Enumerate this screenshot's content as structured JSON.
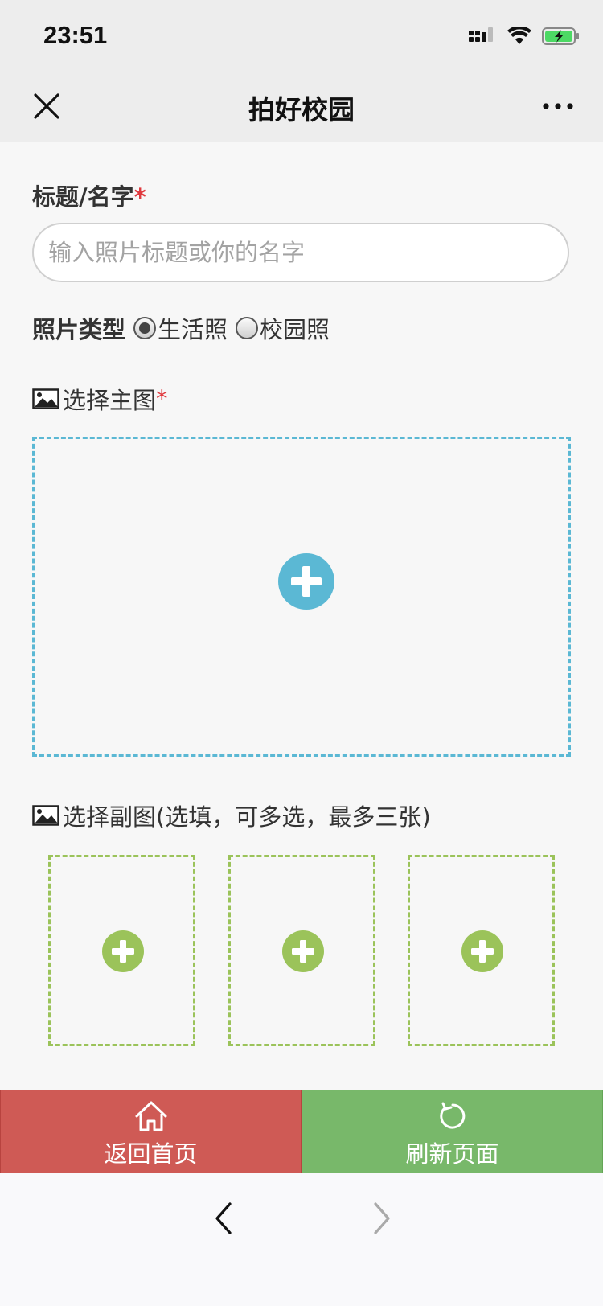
{
  "status_bar": {
    "time": "23:51"
  },
  "nav": {
    "title": "拍好校园"
  },
  "form": {
    "title_label": "标题/名字",
    "required_mark": "*",
    "title_placeholder": "输入照片标题或你的名字",
    "title_value": "",
    "type_label": "照片类型",
    "type_options": [
      {
        "label": "生活照",
        "checked": true
      },
      {
        "label": "校园照",
        "checked": false
      }
    ],
    "main_image_label": "选择主图",
    "sub_image_label": "选择副图(选填，可多选，最多三张)"
  },
  "actions": {
    "home_label": "返回首页",
    "refresh_label": "刷新页面"
  },
  "colors": {
    "main_accent": "#5bb8d4",
    "sub_accent": "#9bc35a",
    "home_button": "#cf5a55",
    "refresh_button": "#78b86a",
    "required": "#e0393e"
  },
  "icons": {
    "status": [
      "signal-icon",
      "wifi-icon",
      "battery-charging-icon"
    ],
    "nav": [
      "close-icon",
      "more-icon"
    ],
    "actions": [
      "home-icon",
      "refresh-icon"
    ],
    "browser": [
      "back-icon",
      "forward-icon"
    ]
  }
}
